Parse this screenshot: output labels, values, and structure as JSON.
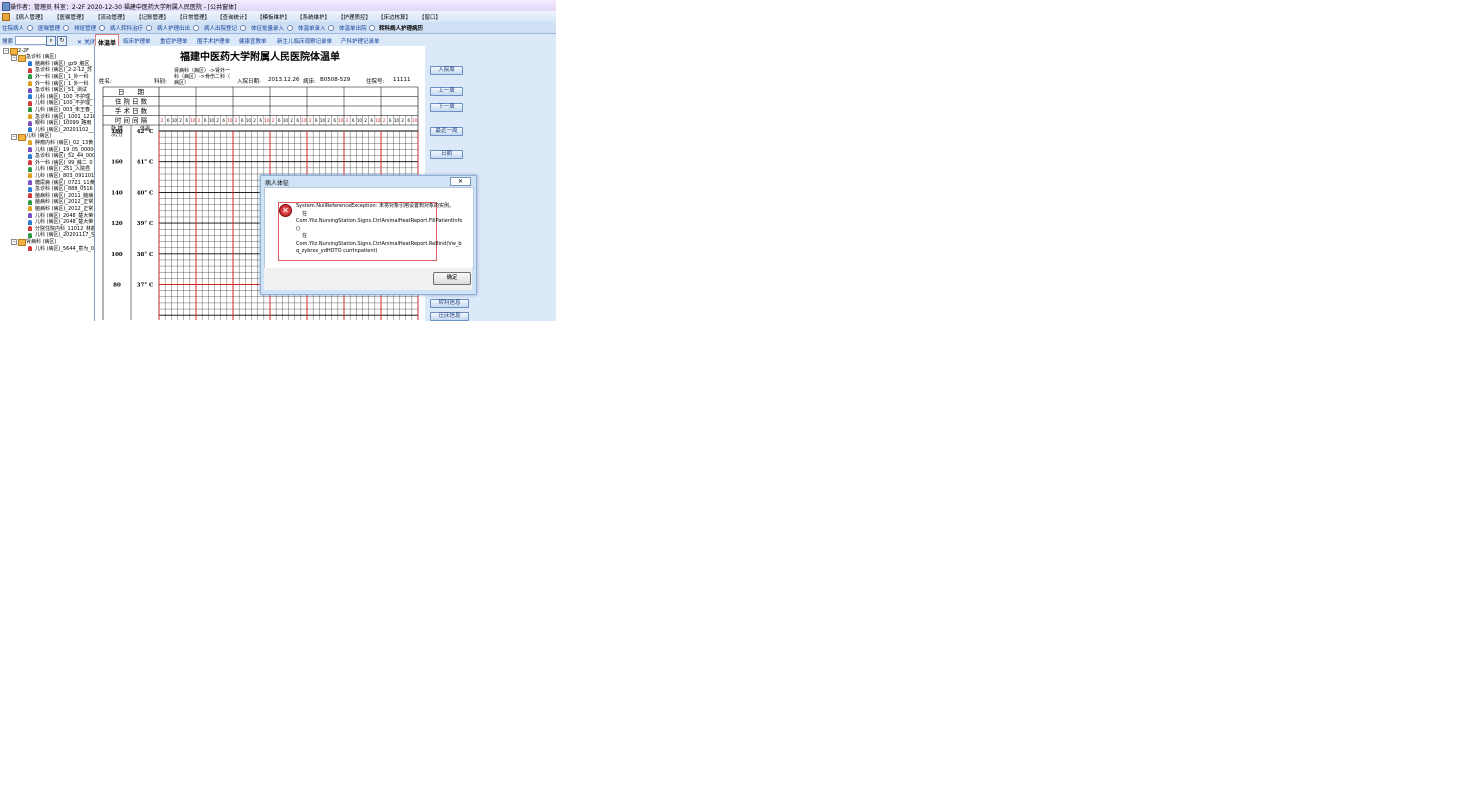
{
  "window": {
    "title": "操作者：管理员  科室：2-2F  2020-12-30  福建中医药大学附属人民医院 - [公共窗体]"
  },
  "menu": [
    "【病人管理】",
    "【医嘱管理】",
    "【流动管理】",
    "【记账管理】",
    "【日常管理】",
    "【查询统计】",
    "【模板维护】",
    "【系统维护】",
    "【护理质控】",
    "【床边核算】",
    "【窗口】"
  ],
  "modules": [
    "住院病人",
    "医嘱管理",
    "排班管理",
    "病人转科治疗",
    "病人护理出出",
    "病人出院登记",
    "体征批量录入",
    "体温单录入",
    "体温单出院",
    "转科病人护理病历"
  ],
  "search": {
    "label": "搜索",
    "value": ""
  },
  "tabs": {
    "close_label": "关闭",
    "items": [
      "体温单",
      "临床护理单",
      "重症护理单",
      "围手术护理单",
      "健康宣教单",
      "新生儿临床观察记录单",
      "产科护理记录单"
    ]
  },
  "tree": {
    "root": "2-2F",
    "groups": [
      {
        "name": "急诊科 (病区)",
        "children": [
          "脑病科 (病区)_gz9_脑区_",
          "急诊科 (病区)_2-2-12_苏",
          "外一科 (病区)_1_外一科",
          "外一科 (病区)_1_外一科",
          "急诊科 (病区)_51_测试",
          "儿科 (病区)_100_不护理_",
          "儿科 (病区)_100_不护理_",
          "儿科 (病区)_003_朱王春_",
          "急诊科 (病区)_1001_1216",
          "眼科 (病区)_10099_路雨",
          "儿科 (病区)_20201102__"
        ]
      },
      {
        "name": "儿科 (病区)",
        "children": [
          "肿瘤内科 (病区)_02_13黄",
          "儿科 (病区)_19_05_00000",
          "急诊科 (病区)_52_44_000",
          "外一科 (病区)_99_薛二_0",
          "儿科 (病区)_251_入院自",
          "儿科 (病区)_803_091101_",
          "糖尿病 (病区)_0721_11黄",
          "急诊科 (病区)_888_0516",
          "脑病科 (病区)_2011_脑病",
          "脑病科 (病区)_2012_正常",
          "脑病科 (病区)_2012_正常",
          "儿科 (病区)_2048_楚大荣",
          "儿科 (病区)_2048_楚大荣",
          "分院住院内科_11012_林静",
          "儿科 (病区)_20201117_空"
        ]
      },
      {
        "name": "肾病科 (病区)",
        "children": [
          "儿科 (病区)_5644_意为_0"
        ]
      }
    ]
  },
  "chart": {
    "title": "福建中医药大学附属人民医院体温单",
    "name_label": "姓名:",
    "dept_label": "科别:",
    "dept_value_1": "肾病科（病区）->肾外一",
    "dept_value_2": "科（病区）->骨伤二科（",
    "dept_value_3": "病区）",
    "admit_label": "入院日期:",
    "admit_value": "2013.12.26",
    "bed_label": "病床:",
    "bed_value": "B0508-529",
    "id_label": "住院号:",
    "id_value": "11111",
    "row_labels": [
      "日　　期",
      "住 院 日 数",
      "手 术 日 数",
      "时 间 间 隔"
    ],
    "time_ticks": [
      "2",
      "6",
      "10",
      "2",
      "6",
      "10"
    ],
    "pulse_header": "脉 搏\n次/分",
    "temp_header": "体温",
    "pulse_scale": [
      "180",
      "160",
      "140",
      "120",
      "100",
      "80"
    ],
    "temp_scale": [
      "42° C",
      "41° C",
      "40° C",
      "39° C",
      "38° C",
      "37° C"
    ]
  },
  "rightbar": {
    "buttons": [
      "入院周",
      "上一周",
      "下一周",
      "最近一周",
      "日期"
    ],
    "bottom_buttons": [
      "转科信息",
      "迁床信息"
    ]
  },
  "dialog": {
    "title": "病人体征",
    "close": "✕",
    "message_1": "System.NullReferenceException: 未将对象引用设置到对象的实例。",
    "message_2": "在",
    "message_3": "Com.Yilz.NursingStation.Signs.CtrlAnimalHeatReport.FillPatientInfo()",
    "message_4": "在",
    "message_5": "Com.Yilz.NursingStation.Signs.CtrlAnimalHeatReport.ReBind(Vw_bq_zybrxx_ydHDTO currInpatient)",
    "ok": "确定"
  },
  "colors": {
    "accent": "#d21f1f",
    "grid": "#000000",
    "panel": "#dce9f8"
  }
}
